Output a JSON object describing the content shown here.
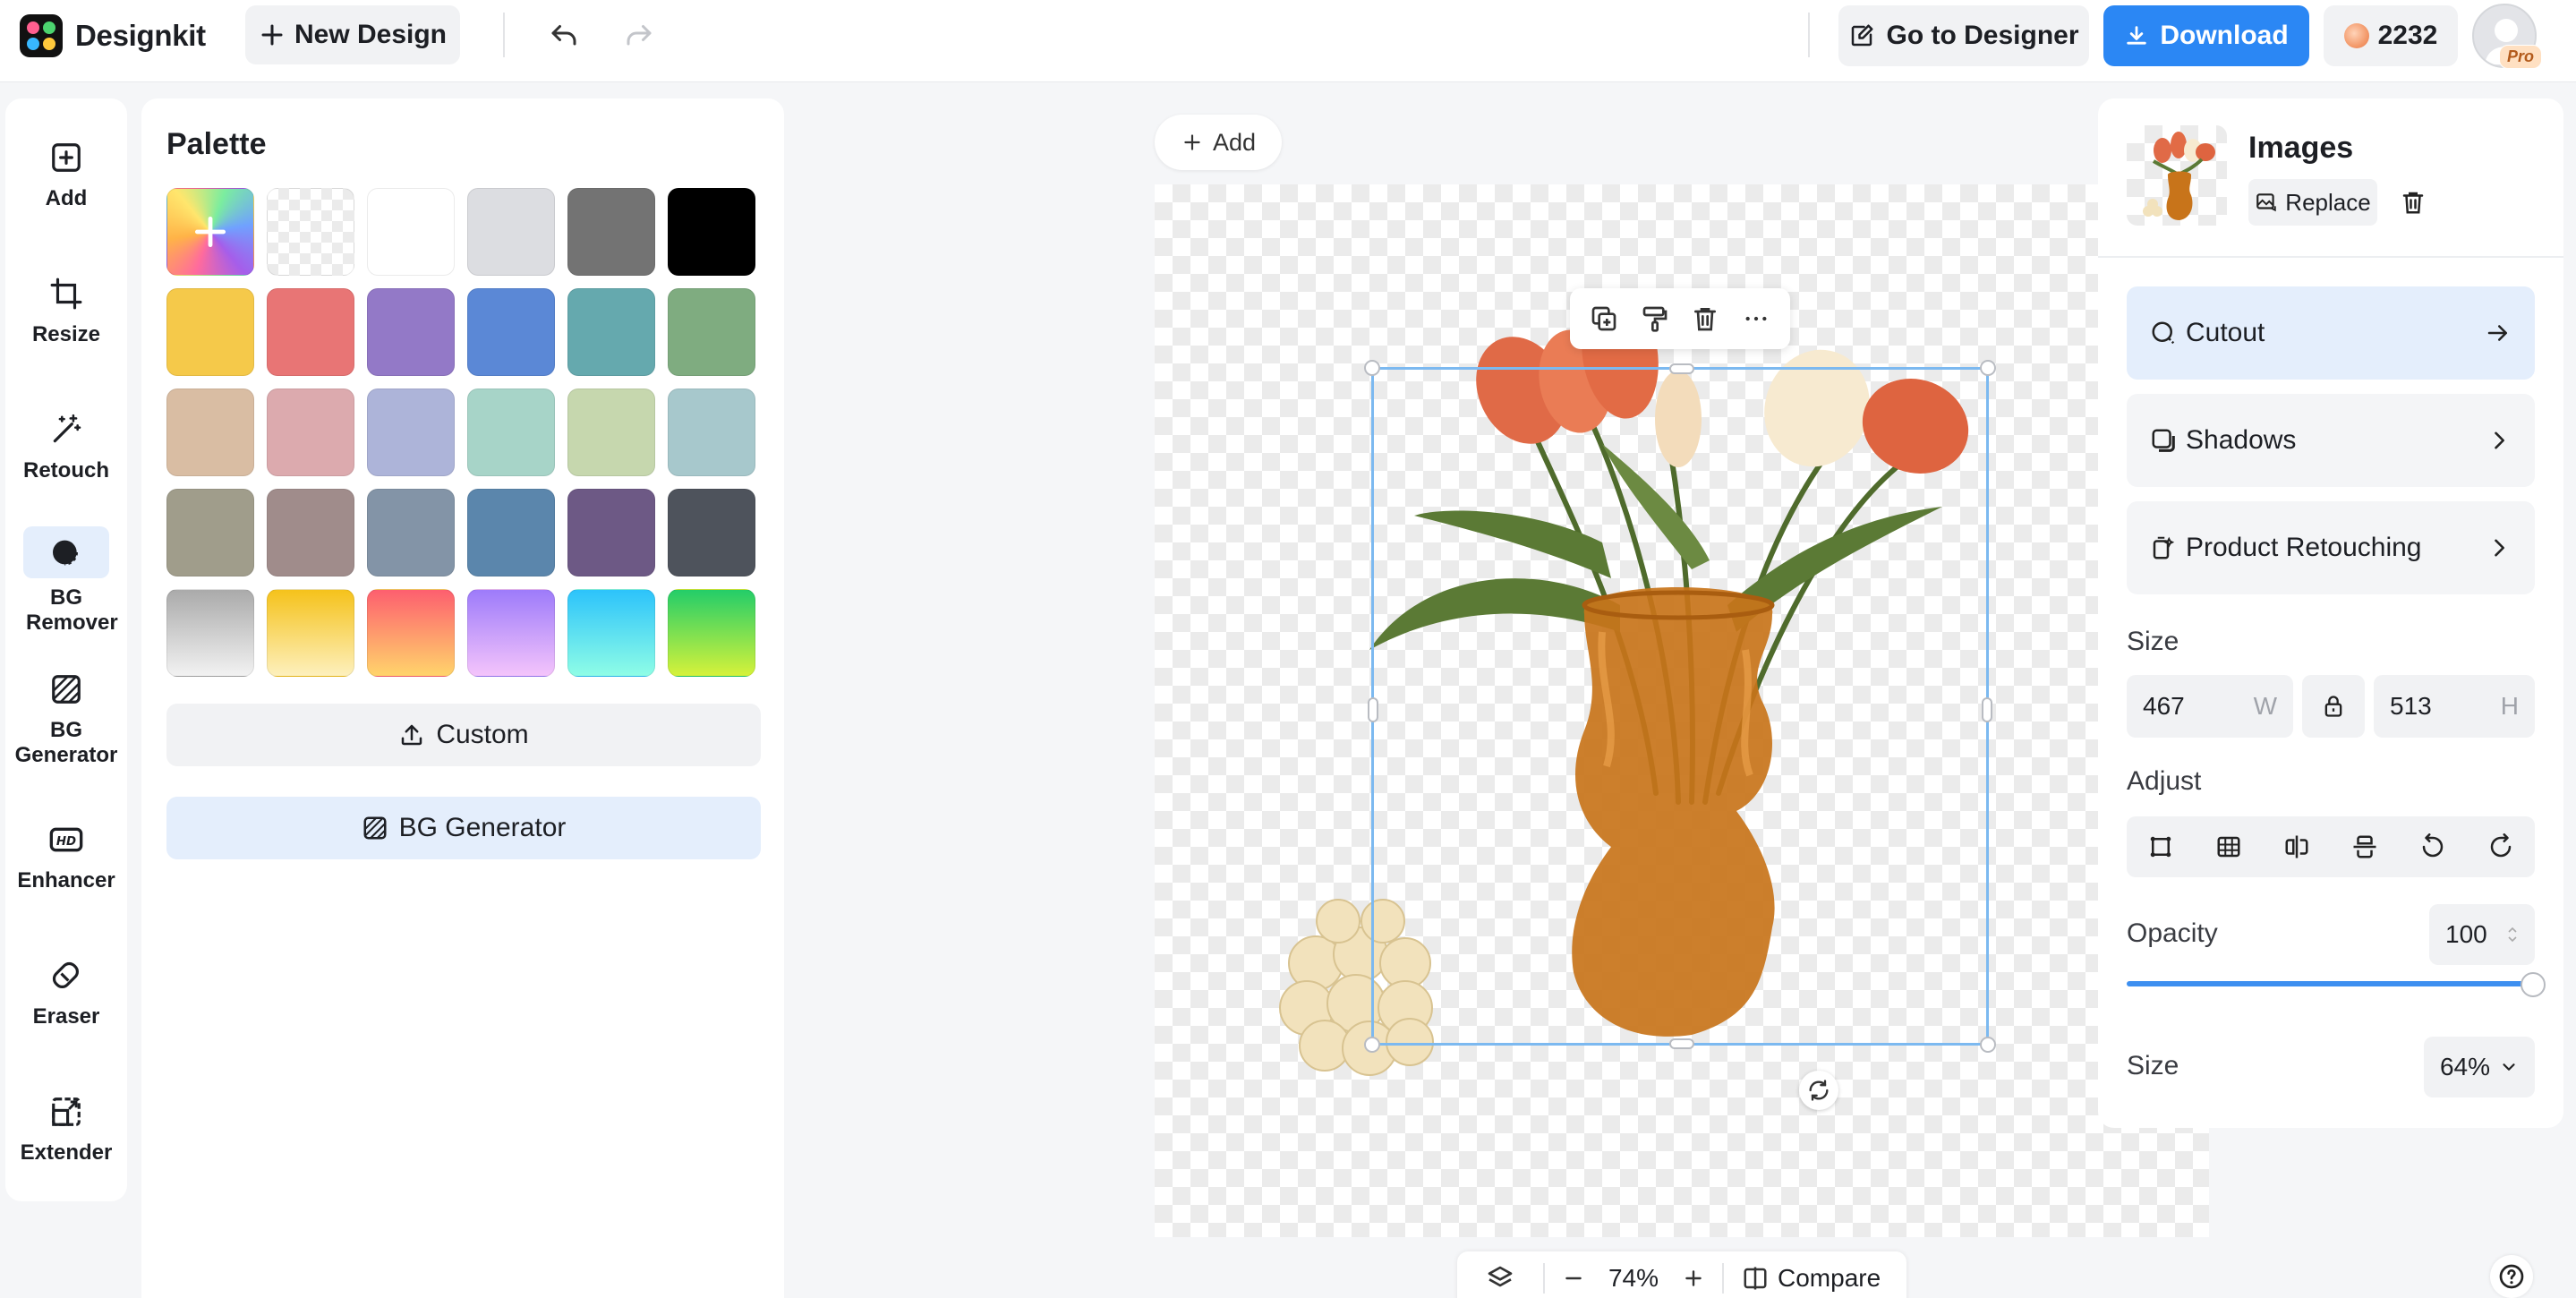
{
  "app": {
    "name": "Designkit"
  },
  "topbar": {
    "new_design": "New Design",
    "go_to_designer": "Go to Designer",
    "download": "Download",
    "credits": "2232",
    "badge": "Pro"
  },
  "rail": {
    "items": [
      {
        "label": "Add",
        "icon": "add-square-icon"
      },
      {
        "label": "Resize",
        "icon": "crop-icon"
      },
      {
        "label": "Retouch",
        "icon": "magic-wand-icon"
      },
      {
        "label": "BG Remover",
        "icon": "bg-remover-icon",
        "active": true
      },
      {
        "label": "BG Generator",
        "icon": "hatch-square-icon"
      },
      {
        "label": "Enhancer",
        "icon": "hd-icon"
      },
      {
        "label": "Eraser",
        "icon": "eraser-icon"
      },
      {
        "label": "Extender",
        "icon": "expand-icon"
      }
    ]
  },
  "palette": {
    "title": "Palette",
    "swatches": [
      "rainbow-add",
      "transparent",
      "#ffffff",
      "#dcdde1",
      "#737373",
      "#000000",
      "#f5c94a",
      "#e87575",
      "#9379c7",
      "#5b88d6",
      "#65a9ae",
      "#7fac80",
      "#d9bda3",
      "#dcaaae",
      "#adb4d9",
      "#a7d4c8",
      "#c6d7ae",
      "#a7c8cc",
      "#a09d8b",
      "#a08c8b",
      "#8394a7",
      "#5b86ac",
      "#6d5985",
      "#4e535c",
      "linear-gradient(#aaaaaa,#f2f2f2)",
      "linear-gradient(#f5c21b,#fdf0bd)",
      "linear-gradient(#fd5f6f,#ffd46b)",
      "linear-gradient(#9d7bfa,#f4c4fb)",
      "linear-gradient(#2cc3fb,#8ffde6)",
      "linear-gradient(#23cd69,#d6f23a)"
    ],
    "custom_label": "Custom",
    "bg_generator_label": "BG Generator"
  },
  "canvas": {
    "add_label": "Add",
    "zoom": "74%",
    "compare_label": "Compare"
  },
  "right_panel": {
    "title": "Images",
    "replace_label": "Replace",
    "cutout": "Cutout",
    "shadows": "Shadows",
    "product_retouching": "Product Retouching",
    "size_label": "Size",
    "width": "467",
    "width_unit": "W",
    "height": "513",
    "height_unit": "H",
    "adjust_label": "Adjust",
    "opacity_label": "Opacity",
    "opacity": "100",
    "opacity_fraction": 1.0,
    "size2_label": "Size",
    "size2_value": "64%"
  },
  "colors": {
    "accent": "#2b87f4",
    "selection": "#7cb9f0"
  }
}
